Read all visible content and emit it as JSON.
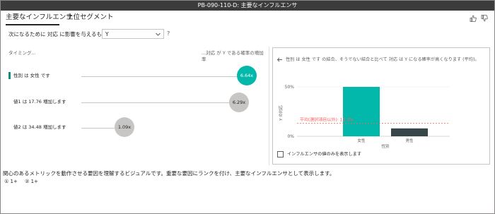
{
  "window": {
    "title": "PB-090-110-D: 主要なインフルエンサ"
  },
  "tabs": [
    {
      "label": "主要なインフルエンサ",
      "active": true
    },
    {
      "label": "上位セグメント",
      "active": false
    }
  ],
  "feedback": {
    "like_icon": "thumbs-up-icon",
    "dislike_icon": "thumbs-down-icon"
  },
  "question": {
    "label": "次になるために 対応 に影響を与えるもの:",
    "selected_value": "Y",
    "help": "?"
  },
  "influencers_panel": {
    "left_header": "タイミング...",
    "right_header": "...対応 が Y である確率の増加率",
    "items": [
      {
        "label": "性別 は 女性 です",
        "value": "6.64x",
        "selected": true
      },
      {
        "label": "値1 は 17.76 増加します",
        "value": "6.29x",
        "selected": false
      },
      {
        "label": "値2 は 34.48 増加します",
        "value": "1.09x",
        "selected": false
      }
    ]
  },
  "detail_panel": {
    "title": "性別 は 女性 です の結合、そうでない結合と比べて 対応 は Y になる確率が高くなります (平均)。",
    "avg_label": "平均(選択項目以外): 13.3%",
    "checkbox_label": "インフルエンサの値のみを表示します",
    "back_icon": "back-arrow-icon"
  },
  "chart_data": {
    "type": "bar",
    "categories": [
      "女性",
      "男性"
    ],
    "values": [
      50,
      8
    ],
    "ylabel": "Y の対応",
    "xlabel": "性別",
    "y_ticks": [
      "0%",
      "50%"
    ],
    "ylim": [
      0,
      60
    ],
    "reference_line": {
      "label": "平均(選択項目以外): 13.3%",
      "value": 13.3
    },
    "colors": [
      "#01b8aa",
      "#374649"
    ],
    "reference_color": "#fd625e"
  },
  "description": "関心のあるメトリックを動作させる要因を理解するビジュアルです。重要な要因にランクを付け、主要なインフルエンサとして表示します。",
  "footer": {
    "count_1": "① 1+",
    "count_2": "② 1+"
  }
}
